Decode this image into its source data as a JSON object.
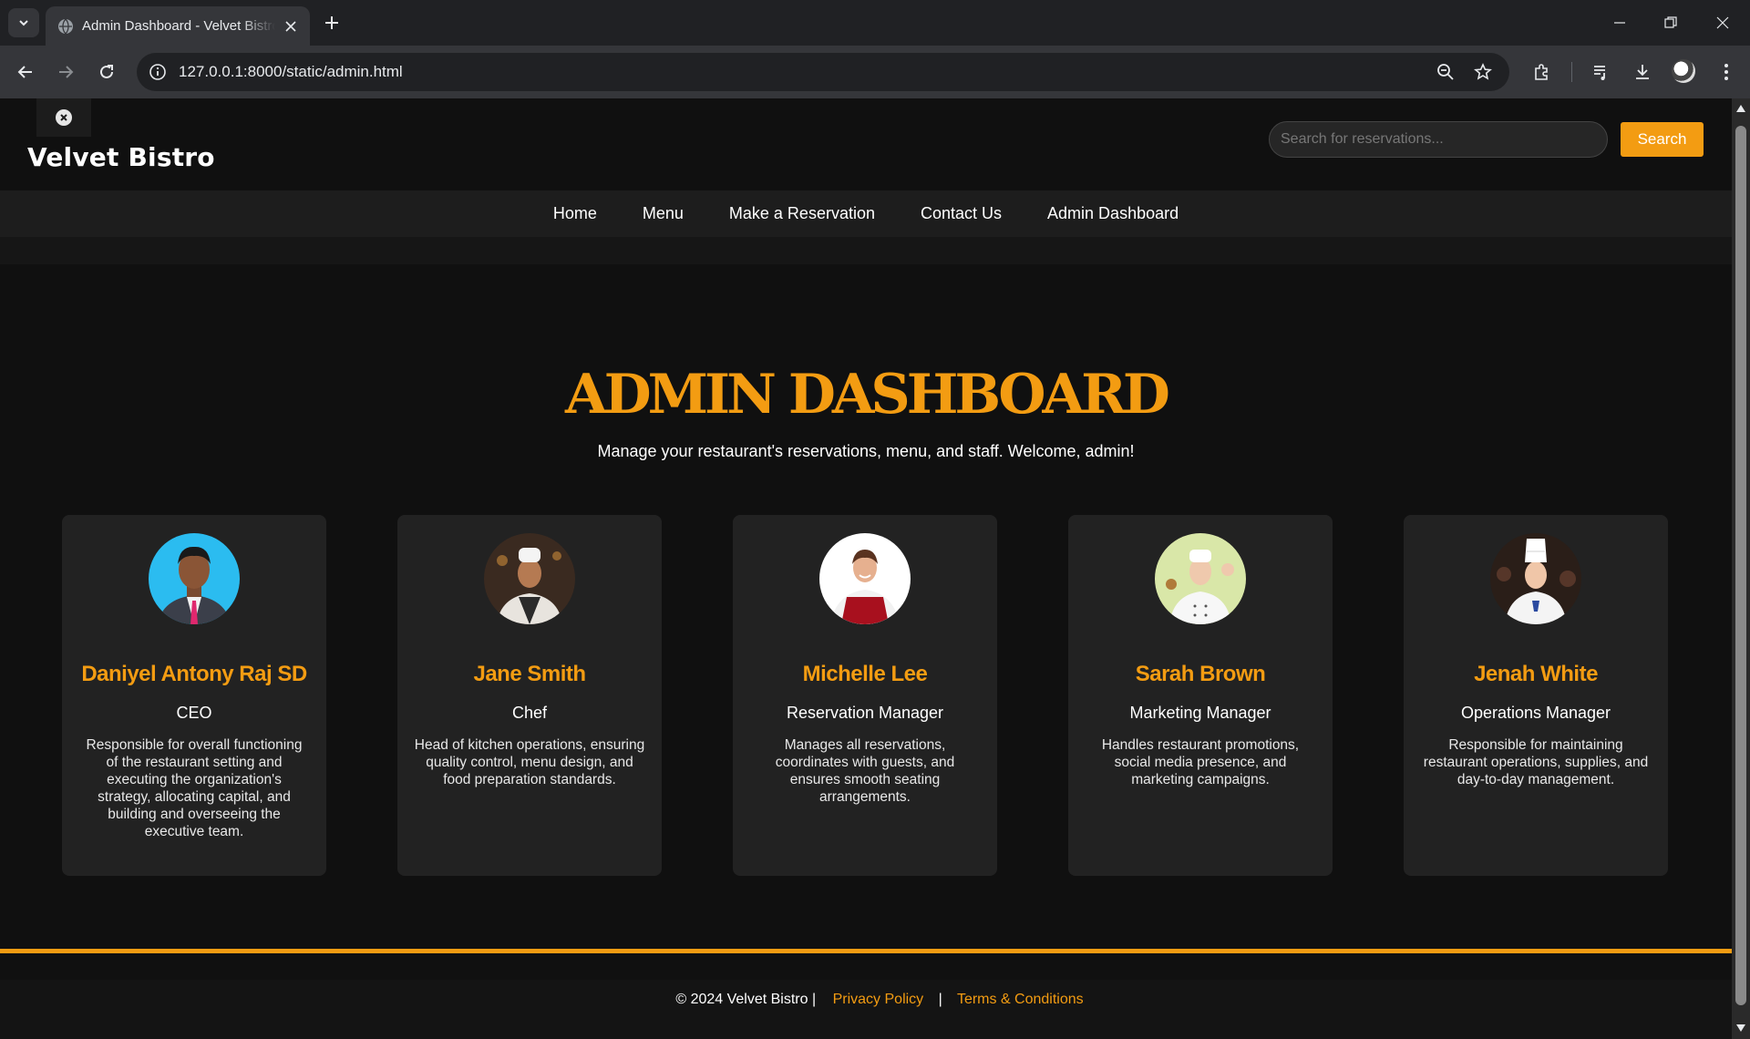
{
  "browser": {
    "tab_title": "Admin Dashboard - Velvet Bistro",
    "url": "127.0.0.1:8000/static/admin.html"
  },
  "site": {
    "brand": "Velvet Bistro",
    "search_placeholder": "Search for reservations...",
    "search_button": "Search",
    "nav": [
      "Home",
      "Menu",
      "Make a Reservation",
      "Contact Us",
      "Admin Dashboard"
    ]
  },
  "main": {
    "title": "ADMIN DASHBOARD",
    "subtitle": "Manage your restaurant's reservations, menu, and staff. Welcome, admin!",
    "staff": [
      {
        "name": "Daniyel Antony Raj SD",
        "role": "CEO",
        "description": "Responsible for overall functioning of the restaurant setting and executing the organization's strategy, allocating capital, and building and overseeing the executive team."
      },
      {
        "name": "Jane Smith",
        "role": "Chef",
        "description": "Head of kitchen operations, ensuring quality control, menu design, and food preparation standards."
      },
      {
        "name": "Michelle Lee",
        "role": "Reservation Manager",
        "description": "Manages all reservations, coordinates with guests, and ensures smooth seating arrangements."
      },
      {
        "name": "Sarah Brown",
        "role": "Marketing Manager",
        "description": "Handles restaurant promotions, social media presence, and marketing campaigns."
      },
      {
        "name": "Jenah White",
        "role": "Operations Manager",
        "description": "Responsible for maintaining restaurant operations, supplies, and day-to-day management."
      }
    ]
  },
  "footer": {
    "copyright": "© 2024 Velvet Bistro |",
    "privacy": "Privacy Policy",
    "separator": "|",
    "terms": "Terms & Conditions"
  },
  "colors": {
    "accent": "#f39c12",
    "background": "#101010",
    "card": "#222222"
  }
}
